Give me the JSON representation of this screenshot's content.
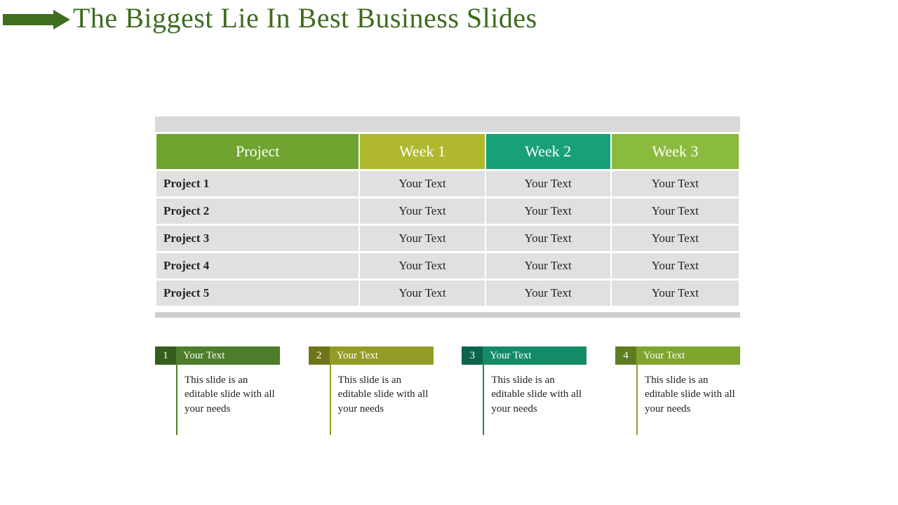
{
  "title": "The Biggest Lie In Best Business Slides",
  "table": {
    "headers": [
      "Project",
      "Week 1",
      "Week 2",
      "Week 3"
    ],
    "rows": [
      {
        "name": "Project 1",
        "cells": [
          "Your Text",
          "Your Text",
          "Your Text"
        ]
      },
      {
        "name": "Project 2",
        "cells": [
          "Your Text",
          "Your Text",
          "Your Text"
        ]
      },
      {
        "name": "Project 3",
        "cells": [
          "Your Text",
          "Your Text",
          "Your Text"
        ]
      },
      {
        "name": "Project 4",
        "cells": [
          "Your Text",
          "Your Text",
          "Your Text"
        ]
      },
      {
        "name": "Project 5",
        "cells": [
          "Your Text",
          "Your Text",
          "Your Text"
        ]
      }
    ]
  },
  "cards": [
    {
      "num": "1",
      "label": "Your Text",
      "body": "This slide is an editable slide with all your needs"
    },
    {
      "num": "2",
      "label": "Your Text",
      "body": "This slide is an editable slide with all your needs"
    },
    {
      "num": "3",
      "label": "Your Text",
      "body": "This slide is an editable slide with all your needs"
    },
    {
      "num": "4",
      "label": "Your Text",
      "body": "This slide is an editable slide with all your needs"
    }
  ],
  "colors": {
    "title": "#3d6b1e",
    "arrow": "#3e6e1e",
    "headers": [
      "#6ea42f",
      "#b0b82d",
      "#18a077",
      "#8bbb3e"
    ]
  }
}
